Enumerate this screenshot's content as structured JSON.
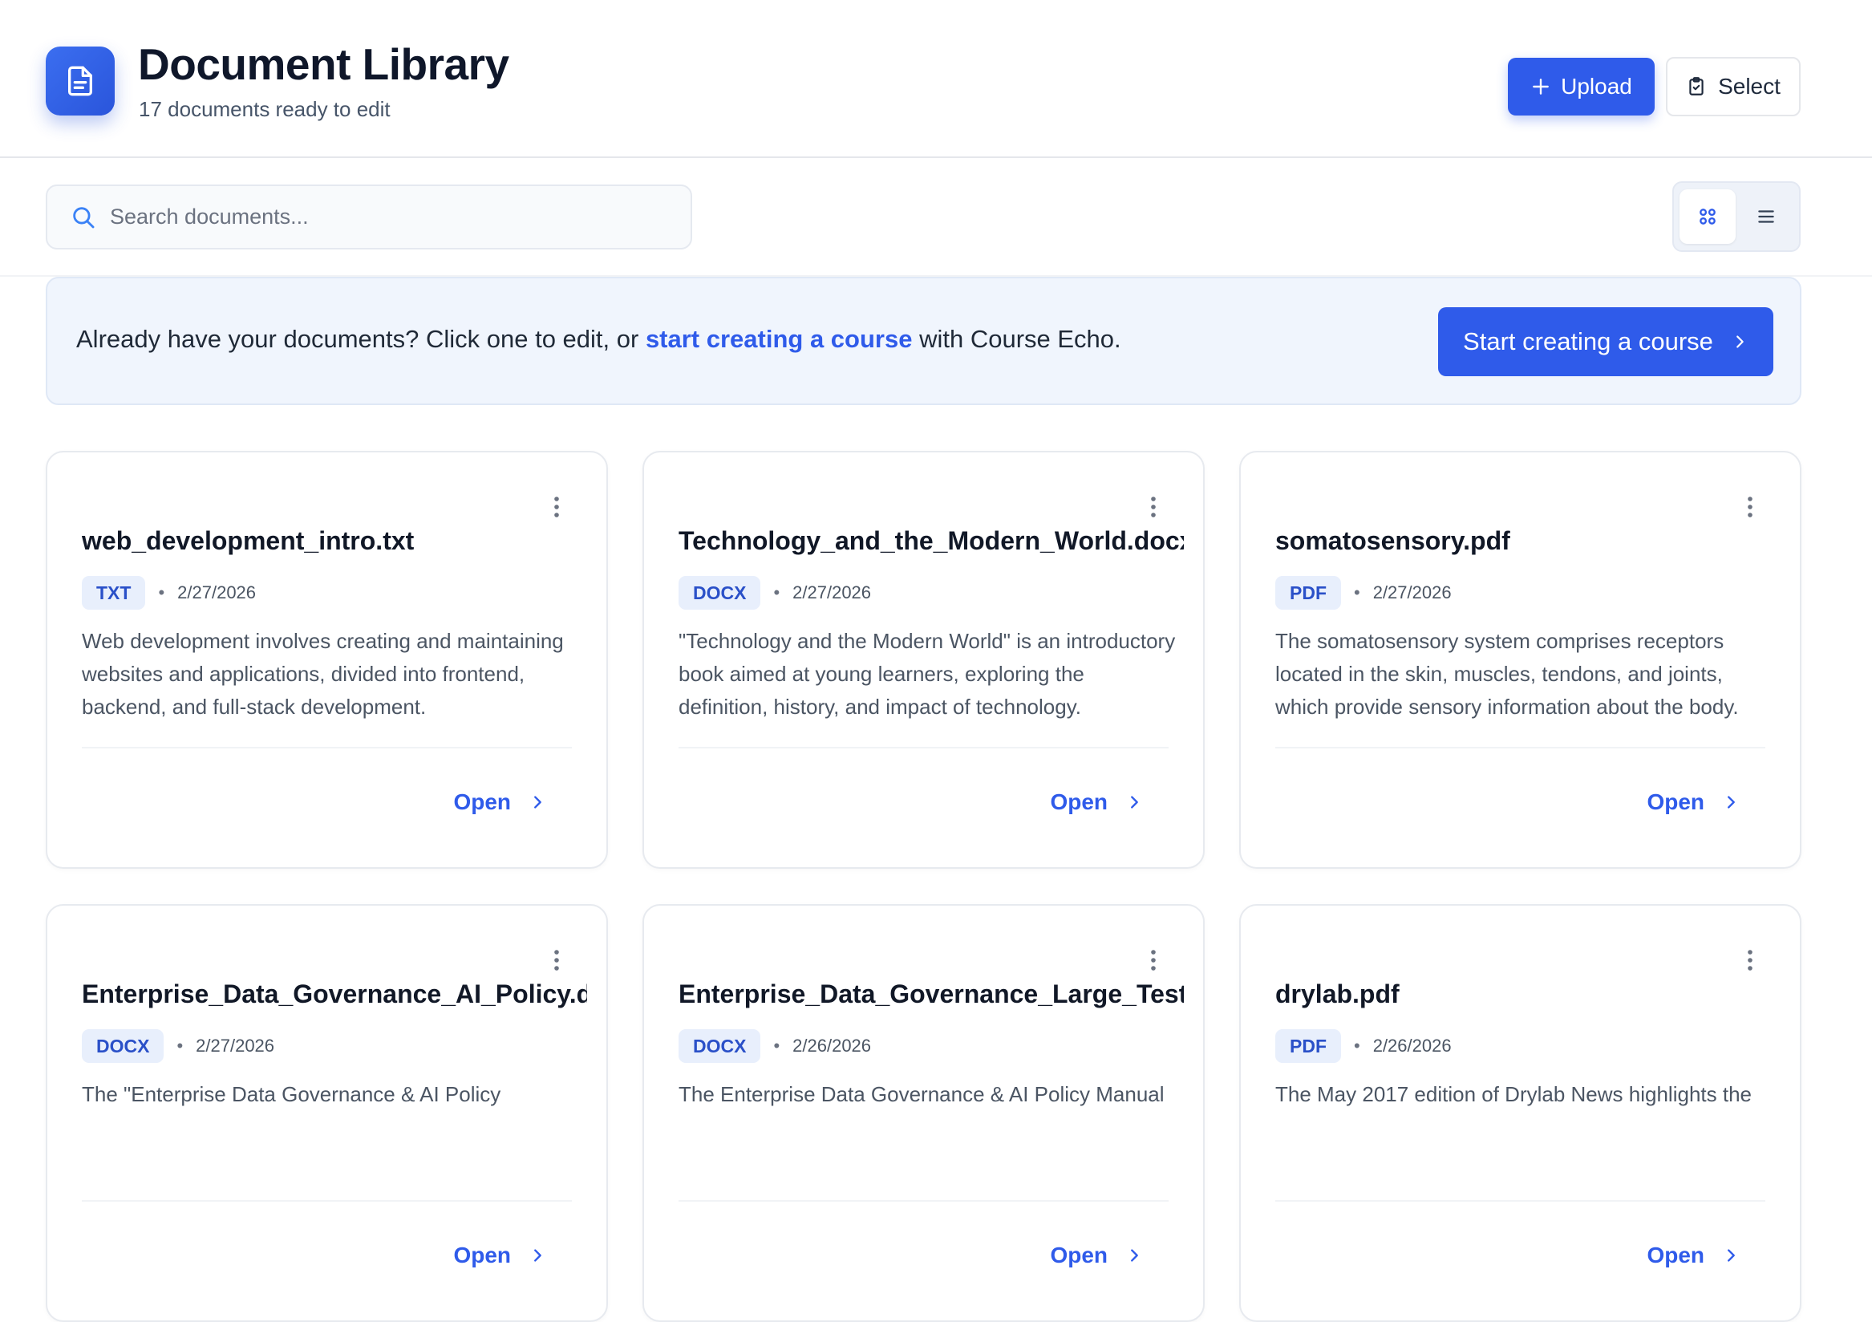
{
  "header": {
    "title": "Document Library",
    "subtitle": "17 documents ready to edit",
    "upload_label": "Upload",
    "select_label": "Select"
  },
  "search": {
    "placeholder": "Search documents..."
  },
  "banner": {
    "text_before": "Already have your documents? Click one to edit, or ",
    "link_text": "start creating a course",
    "text_after": " with Course Echo.",
    "button_label": "Start creating a course"
  },
  "colors": {
    "accent": "#2f5bea",
    "badge_bg": "#e8effc",
    "banner_bg": "#f0f5fd"
  },
  "documents": [
    {
      "name": "web_development_intro.txt",
      "type": "TXT",
      "date": "2/27/2026",
      "description": "Web development involves creating and maintaining websites and applications, divided into frontend, backend, and full-stack development.",
      "open_label": "Open"
    },
    {
      "name": "Technology_and_the_Modern_World.docx",
      "type": "DOCX",
      "date": "2/27/2026",
      "description": "\"Technology and the Modern World\" is an introductory book aimed at young learners, exploring the definition, history, and impact of technology.",
      "open_label": "Open"
    },
    {
      "name": "somatosensory.pdf",
      "type": "PDF",
      "date": "2/27/2026",
      "description": "The somatosensory system comprises receptors located in the skin, muscles, tendons, and joints, which provide sensory information about the body.",
      "open_label": "Open"
    },
    {
      "name": "Enterprise_Data_Governance_AI_Policy.do",
      "type": "DOCX",
      "date": "2/27/2026",
      "description": "The \"Enterprise Data Governance & AI Policy",
      "open_label": "Open"
    },
    {
      "name": "Enterprise_Data_Governance_Large_Test.c",
      "type": "DOCX",
      "date": "2/26/2026",
      "description": "The Enterprise Data Governance & AI Policy Manual",
      "open_label": "Open"
    },
    {
      "name": "drylab.pdf",
      "type": "PDF",
      "date": "2/26/2026",
      "description": "The May 2017 edition of Drylab News highlights the",
      "open_label": "Open"
    }
  ]
}
